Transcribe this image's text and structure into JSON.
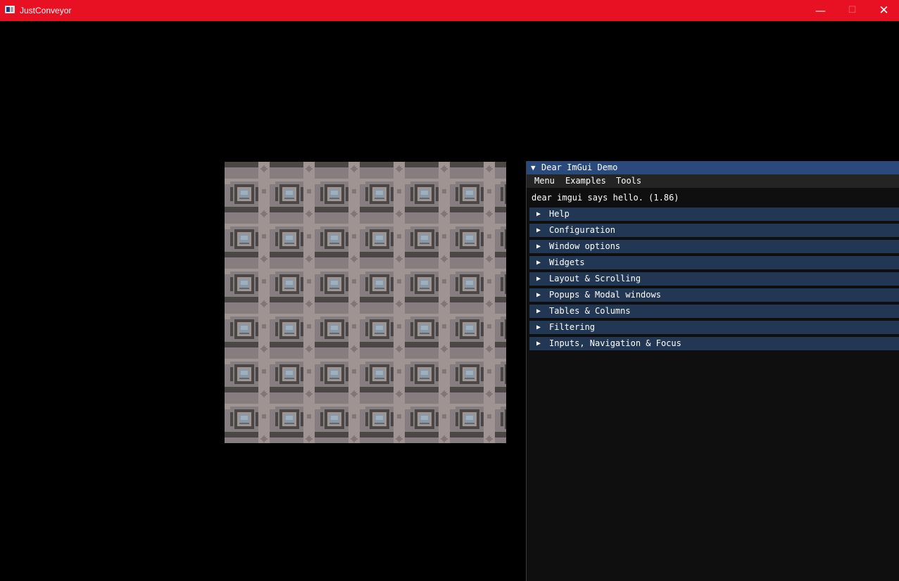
{
  "window": {
    "title": "JustConveyor",
    "minimize_glyph": "—",
    "maximize_glyph": "☐",
    "close_glyph": "✕"
  },
  "imgui_demo": {
    "title": "Dear ImGui Demo",
    "title_arrow": "▼",
    "menu": [
      "Menu",
      "Examples",
      "Tools"
    ],
    "hello": "dear imgui says hello. (1.86)",
    "section_arrow": "▶",
    "sections": [
      "Help",
      "Configuration",
      "Window options",
      "Widgets",
      "Layout & Scrolling",
      "Popups & Modal windows",
      "Tables & Columns",
      "Filtering",
      "Inputs, Navigation & Focus"
    ]
  },
  "colors": {
    "titlebar": "#e81123",
    "imgui_title": "#294a7a",
    "imgui_header": "#213754",
    "imgui_menubar": "#242424",
    "imgui_bg": "#0f0f0f"
  },
  "icons": {
    "app": "app-icon",
    "minimize": "minimize-icon",
    "maximize": "maximize-icon",
    "close": "close-icon",
    "collapse": "collapse-arrow-icon",
    "expand": "expand-arrow-icon"
  }
}
